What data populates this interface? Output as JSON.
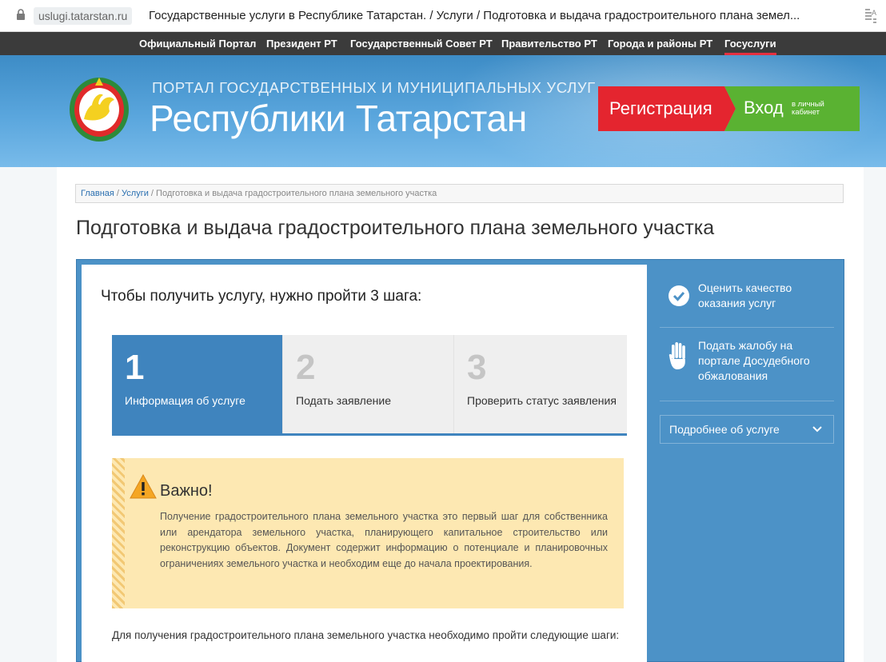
{
  "browser": {
    "domain": "uslugi.tatarstan.ru",
    "page_title": "Государственные услуги в Республике Татарстан. / Услуги / Подготовка и выдача градостроительного плана земел..."
  },
  "topnav": {
    "items": [
      "Официальный Портал",
      "Президент РТ",
      "Государственный Совет РТ",
      "Правительство РТ",
      "Города и районы РТ",
      "Госуслуги"
    ],
    "active_index": 5
  },
  "header": {
    "portal_subtitle": "ПОРТАЛ ГОСУДАРСТВЕННЫХ И МУНИЦИПАЛЬНЫХ УСЛУГ",
    "portal_title": "Республики Татарстан",
    "register_label": "Регистрация",
    "login_label": "Вход",
    "login_sub": "в личный кабинет"
  },
  "breadcrumb": {
    "home": "Главная",
    "services": "Услуги",
    "current": "Подготовка и выдача градостроительного плана земельного участка",
    "sep": " / "
  },
  "page_title": "Подготовка и выдача градостроительного плана земельного участка",
  "service": {
    "steps_title": "Чтобы получить услугу, нужно пройти 3 шага:",
    "steps": [
      {
        "num": "1",
        "label": "Информация об услуге"
      },
      {
        "num": "2",
        "label": "Подать заявление"
      },
      {
        "num": "3",
        "label": "Проверить статус заявления"
      }
    ],
    "active_step": 1,
    "warning": {
      "title": "Важно!",
      "text": "Получение градостроительного плана земельного участка это первый шаг для собственника или арендатора земельного участка, планирующего капитальное строительство или реконструкцию объектов. Документ содержит информацию о потенциале и планировочных ограничениях земельного участка и необходим еще до начала проектирования."
    },
    "intro": "Для получения градостроительного плана земельного участка необходимо пройти следующие шаги:"
  },
  "sidebar": {
    "rate_label": "Оценить качество оказания услуг",
    "complaint_label": "Подать жалобу на портале Досудебного обжалования",
    "more_label": "Подробнее об услуге"
  },
  "colors": {
    "accent_blue": "#3f84be",
    "register_red": "#e4252f",
    "login_green": "#5ab232",
    "warning_bg": "#fde8b2"
  }
}
